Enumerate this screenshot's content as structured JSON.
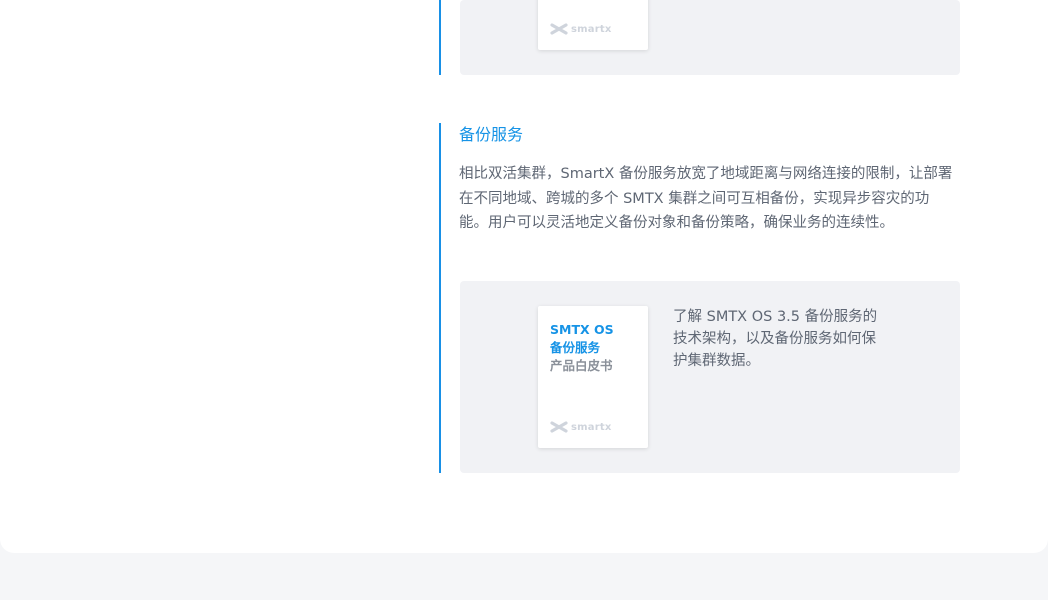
{
  "colors": {
    "accent": "#1693e6",
    "page_background": "#f5f6f8",
    "card_background": "#ffffff",
    "resource_background": "#f1f2f5",
    "body_text": "#5f6774",
    "cover_subtitle": "#8a9099"
  },
  "sections": [
    {
      "title": "",
      "resource": {
        "cover_title_lines": [],
        "cover_subtitle": "",
        "logo_text": "smartx",
        "logo_icon": "smartx-logo-icon",
        "description": ""
      }
    },
    {
      "title": "备份服务",
      "description": "相比双活集群，SmartX 备份服务放宽了地域距离与网络连接的限制，让部署在不同地域、跨城的多个 SMTX 集群之间可互相备份，实现异步容灾的功能。用户可以灵活地定义备份对象和备份策略，确保业务的连续性。",
      "resource": {
        "cover_title_lines": [
          "SMTX OS",
          "备份服务"
        ],
        "cover_subtitle": "产品白皮书",
        "logo_text": "smartx",
        "logo_icon": "smartx-logo-icon",
        "description": "了解 SMTX OS 3.5 备份服务的技术架构，以及备份服务如何保护集群数据。"
      }
    }
  ]
}
